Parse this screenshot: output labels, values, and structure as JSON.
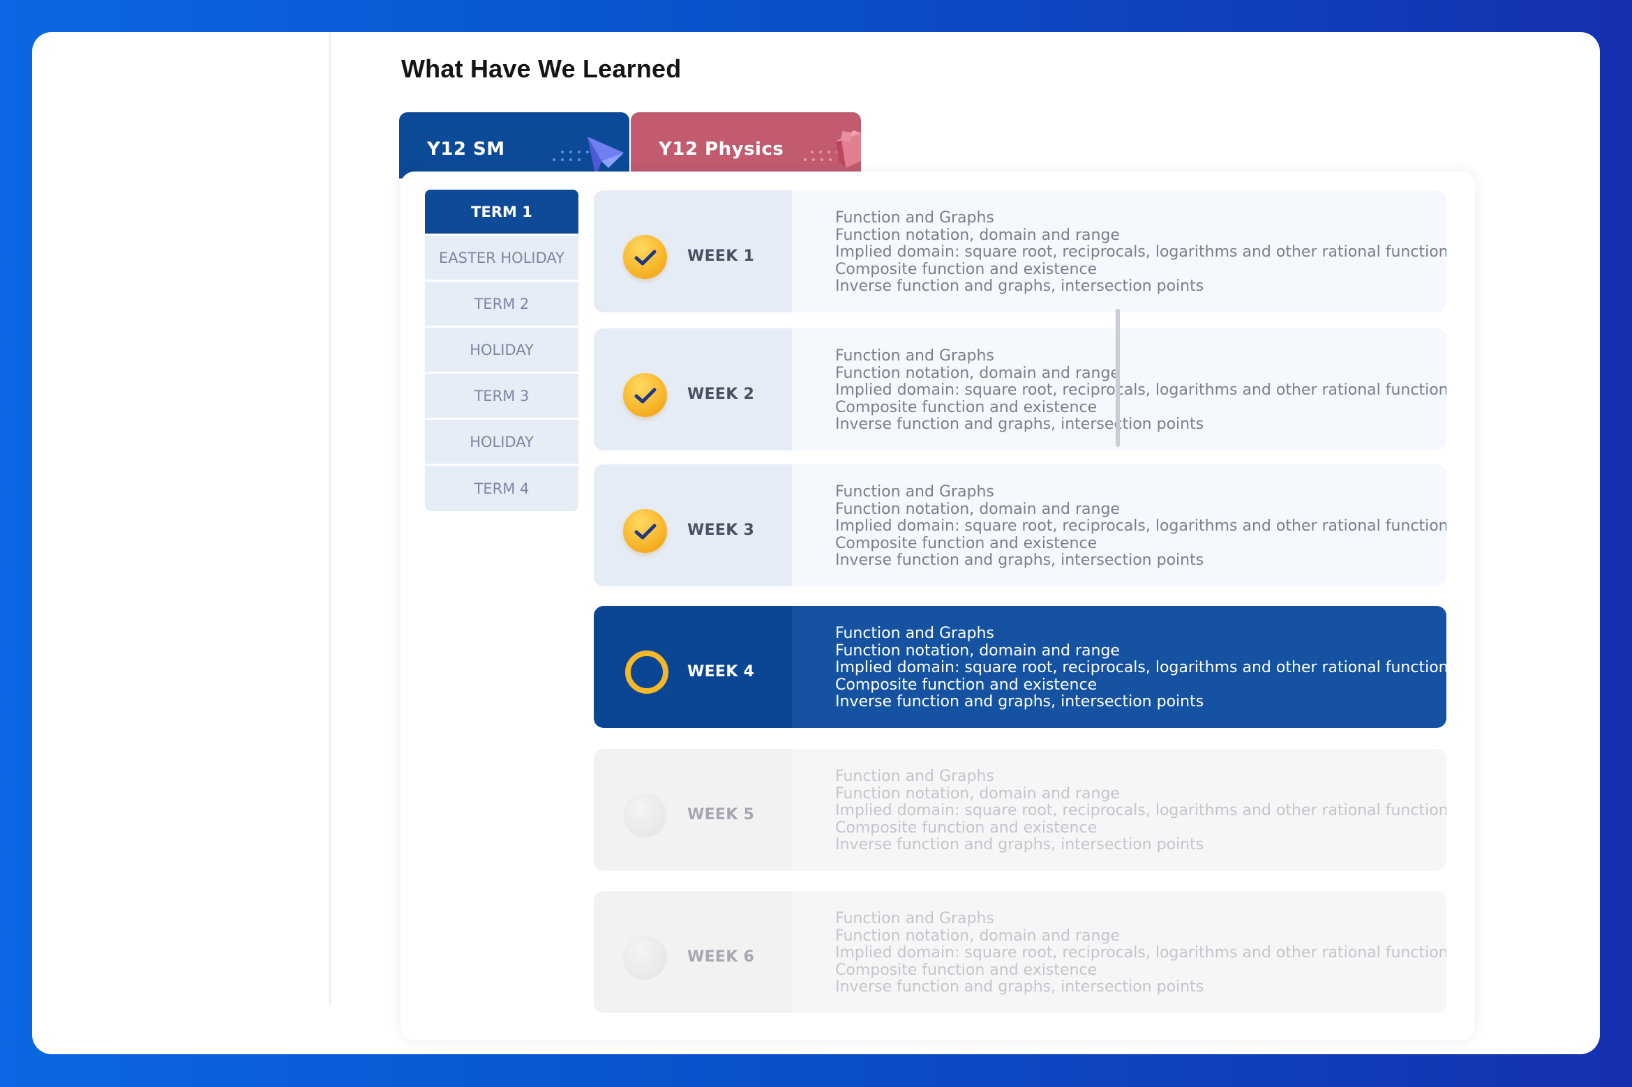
{
  "page_title": "What Have We Learned",
  "tabs": [
    {
      "label": "Y12  SM",
      "active": true,
      "color": "#0b4a96"
    },
    {
      "label": "Y12  Physics",
      "active": false,
      "color": "#c25b6d"
    }
  ],
  "terms": [
    {
      "label": "TERM 1",
      "active": true
    },
    {
      "label": "EASTER HOLIDAY"
    },
    {
      "label": "TERM 2"
    },
    {
      "label": "HOLIDAY"
    },
    {
      "label": "TERM 3"
    },
    {
      "label": "HOLIDAY"
    },
    {
      "label": "TERM 4"
    }
  ],
  "weeks": [
    {
      "label": "WEEK 1",
      "status": "done",
      "topics": [
        "Function and Graphs",
        "Function notation, domain and range",
        "Implied domain: square root, reciprocals, logarithms and other rational functions",
        "Composite function and existence",
        "Inverse function and graphs, intersection points"
      ]
    },
    {
      "label": "WEEK 2",
      "status": "done",
      "topics": [
        "Function and Graphs",
        "Function notation, domain and range",
        "Implied domain: square root, reciprocals, logarithms and other rational functions",
        "Composite function and existence",
        "Inverse function and graphs, intersection points"
      ]
    },
    {
      "label": "WEEK 3",
      "status": "done",
      "topics": [
        "Function and Graphs",
        "Function notation, domain and range",
        "Implied domain: square root, reciprocals, logarithms and other rational functions",
        "Composite function and existence",
        "Inverse function and graphs, intersection points"
      ]
    },
    {
      "label": "WEEK 4",
      "status": "current",
      "topics": [
        "Function and Graphs",
        "Function notation, domain and range",
        "Implied domain: square root, reciprocals, logarithms and other rational functions",
        "Composite function and existence",
        "Inverse function and graphs, intersection points"
      ]
    },
    {
      "label": "WEEK 5",
      "status": "future",
      "topics": [
        "Function and Graphs",
        "Function notation, domain and range",
        "Implied domain: square root, reciprocals, logarithms and other rational functions",
        "Composite function and existence",
        "Inverse function and graphs, intersection points"
      ]
    },
    {
      "label": "WEEK 6",
      "status": "future",
      "topics": [
        "Function and Graphs",
        "Function notation, domain and range",
        "Implied domain: square root, reciprocals, logarithms and other rational functions",
        "Composite function and existence",
        "Inverse function and graphs, intersection points"
      ]
    }
  ],
  "icons": {
    "done": "checkmark-icon",
    "current": "in-progress-ring-icon",
    "future": "pending-circle-icon"
  },
  "colors": {
    "primary": "#0b4a96",
    "physics": "#c25b6d",
    "accent": "#f6b828"
  }
}
